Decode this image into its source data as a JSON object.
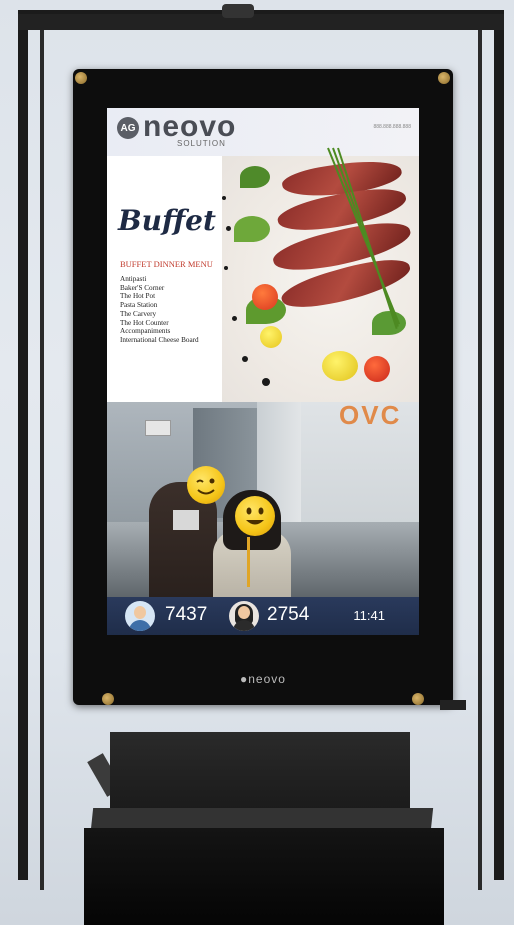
{
  "screen": {
    "brand": {
      "badge": "AG",
      "name": "neovo",
      "sub": "SOLUTION"
    },
    "address": "888.888.888.888",
    "title": "Buffet",
    "menu_heading": "BUFFET DINNER MENU",
    "menu_items": [
      "Antipasti",
      "Baker'S Corner",
      "The Hot Pot",
      "Pasta Station",
      "The Carvery",
      "The Hot Counter",
      "Accompaniments",
      "International Cheese Board"
    ],
    "camera_sign": "OVC",
    "stats": {
      "male_count": "7437",
      "female_count": "2754",
      "time": "11:41"
    }
  },
  "bezel_logo": "neovo",
  "colors": {
    "stats_bar": "#1f2d4a",
    "title_navy": "#1e2a44",
    "menu_heading_red": "#c0392b",
    "emoji_yellow": "#f5c518",
    "frame_black": "#1b1b1b"
  },
  "icons": {
    "male_avatar": "male-avatar-icon",
    "female_avatar": "female-avatar-icon",
    "face_emoji": "smiley-emoji-icon"
  }
}
